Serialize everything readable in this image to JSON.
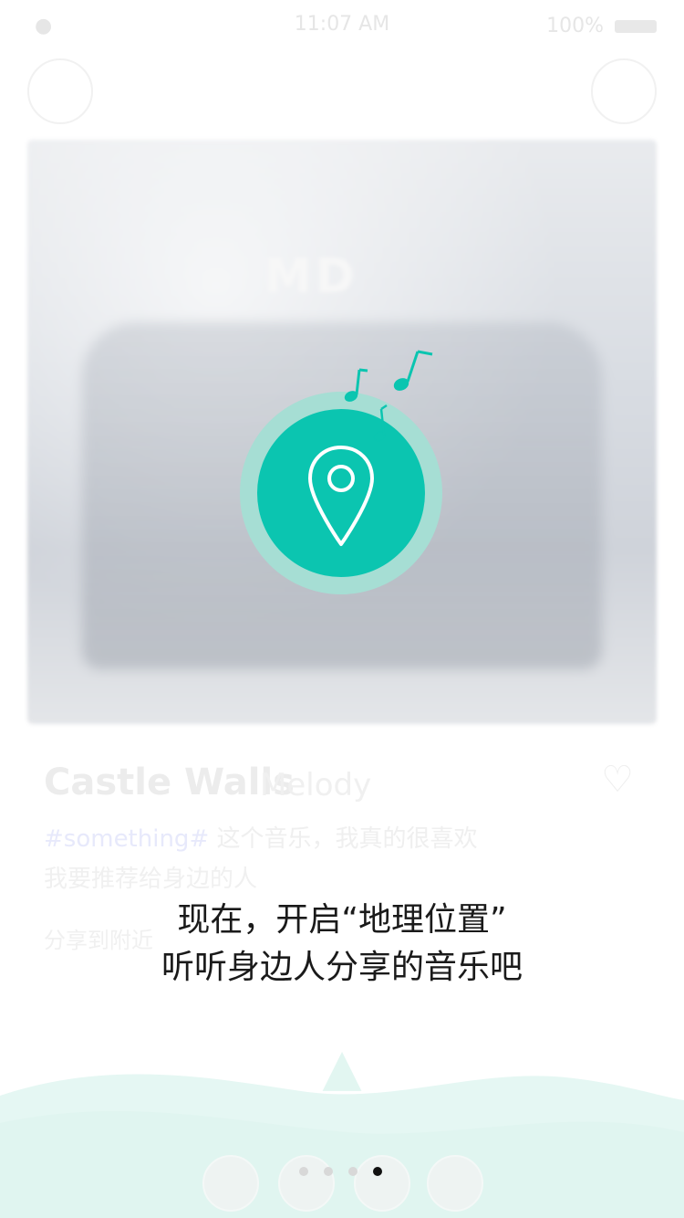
{
  "background": {
    "song": {
      "title": "Castle Walls",
      "subtitle": "Melody",
      "tag": "#something#",
      "description_line1": "这个音乐，我真的很喜欢",
      "description_line2": "我要推荐给身边的人",
      "extra": "分享到附近"
    },
    "status": {
      "time": "11:07 AM",
      "battery_label": "100%"
    }
  },
  "prompt": {
    "line1": "现在，开启“地理位置”",
    "line2": "听听身边人分享的音乐吧"
  },
  "pager": {
    "count": 4,
    "active_index": 3
  },
  "colors": {
    "accent": "#0bc5b0",
    "accent_ring": "#a6ded4",
    "wave": "#e5f7f3"
  },
  "icons": {
    "location": "location-pin-icon",
    "notes": "music-notes-icon",
    "heart": "heart-icon",
    "arrow": "up-arrow-icon"
  }
}
